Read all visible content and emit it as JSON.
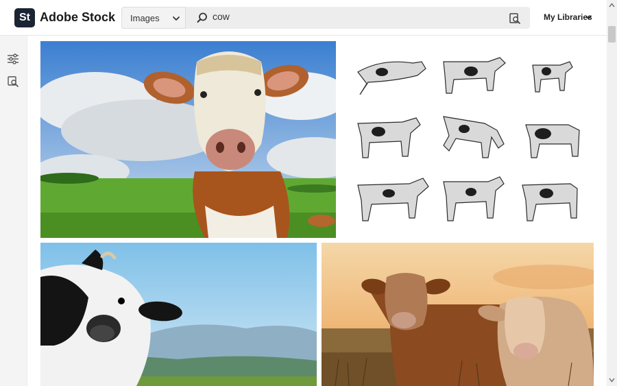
{
  "app": {
    "logo_text": "St",
    "brand_name": "Adobe Stock"
  },
  "search": {
    "type_selected": "Images",
    "query": "cow",
    "icons": {
      "search": "search-icon",
      "type_dropdown": "chevron-down-icon",
      "visual_search": "visual-search-icon"
    }
  },
  "header": {
    "libraries_label": "My Libraries",
    "libraries_icon": "chevron-down-icon"
  },
  "rail": {
    "items": [
      {
        "icon": "filter-sliders-icon"
      },
      {
        "icon": "visual-search-icon"
      }
    ]
  },
  "results": [
    {
      "subject": "brown-white-cow-closeup-meadow"
    },
    {
      "subject": "cow-sketch-illustration-set"
    },
    {
      "subject": "black-white-cow-mountains"
    },
    {
      "subject": "brown-cows-sunset-field"
    }
  ],
  "colors": {
    "logo_bg": "#1b2433",
    "search_bg": "#ededed",
    "rail_bg": "#f4f4f4"
  }
}
